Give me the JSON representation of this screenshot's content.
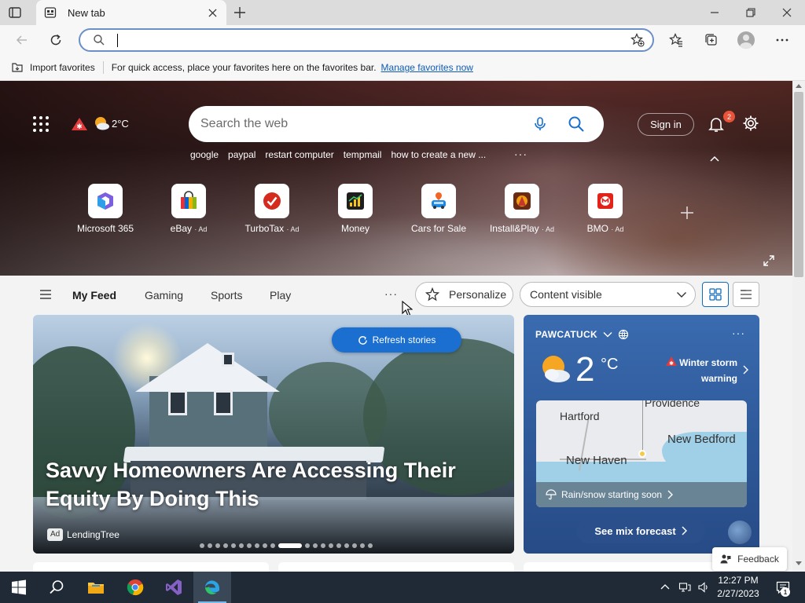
{
  "browser": {
    "tab_title": "New tab",
    "address_value": "",
    "favorites_bar": {
      "import_label": "Import favorites",
      "hint_text": "For quick access, place your favorites here on the favorites bar.",
      "manage_link": "Manage favorites now"
    }
  },
  "ntp": {
    "hero_temperature": "2°C",
    "search_placeholder": "Search the web",
    "sign_in_label": "Sign in",
    "notification_count": "2",
    "trending": [
      "google",
      "paypal",
      "restart computer",
      "tempmail",
      "how to create a new ..."
    ],
    "trending_more": "···",
    "tiles": [
      {
        "label": "Microsoft 365",
        "ad": ""
      },
      {
        "label": "eBay",
        "ad": "· Ad"
      },
      {
        "label": "TurboTax",
        "ad": "· Ad"
      },
      {
        "label": "Money",
        "ad": ""
      },
      {
        "label": "Cars for Sale",
        "ad": ""
      },
      {
        "label": "Install&Play",
        "ad": "· Ad"
      },
      {
        "label": "BMO",
        "ad": "· Ad"
      }
    ]
  },
  "feed": {
    "tabs": [
      "My Feed",
      "Gaming",
      "Sports",
      "Play"
    ],
    "more": "···",
    "personalize_label": "Personalize",
    "content_select_value": "Content visible",
    "refresh_label": "Refresh stories",
    "headline": "Savvy Homeowners Are Accessing Their Equity By Doing This",
    "ad_badge": "Ad",
    "source": "LendingTree",
    "carousel_dot_count": 20,
    "carousel_active_index": 10,
    "feedback_label": "Feedback"
  },
  "weather": {
    "location": "PAWCATUCK",
    "more": "···",
    "temperature": "2",
    "unit": "°C",
    "warning_line1": "Winter storm",
    "warning_line2": "warning",
    "map_labels": {
      "hartford": "Hartford",
      "providence": "Providence",
      "new_bedford": "New Bedford",
      "new_haven": "New Haven"
    },
    "precip_text": "Rain/snow starting soon",
    "forecast_button": "See mix forecast"
  },
  "taskbar": {
    "time": "12:27 PM",
    "date": "2/27/2023",
    "notification_count": "1"
  },
  "colors": {
    "accent": "#0f6cbd",
    "link": "#0f5bb5",
    "refresh_button": "#1a6fd0",
    "weather_card": "#2d5796",
    "taskbar": "#1f2a36"
  }
}
